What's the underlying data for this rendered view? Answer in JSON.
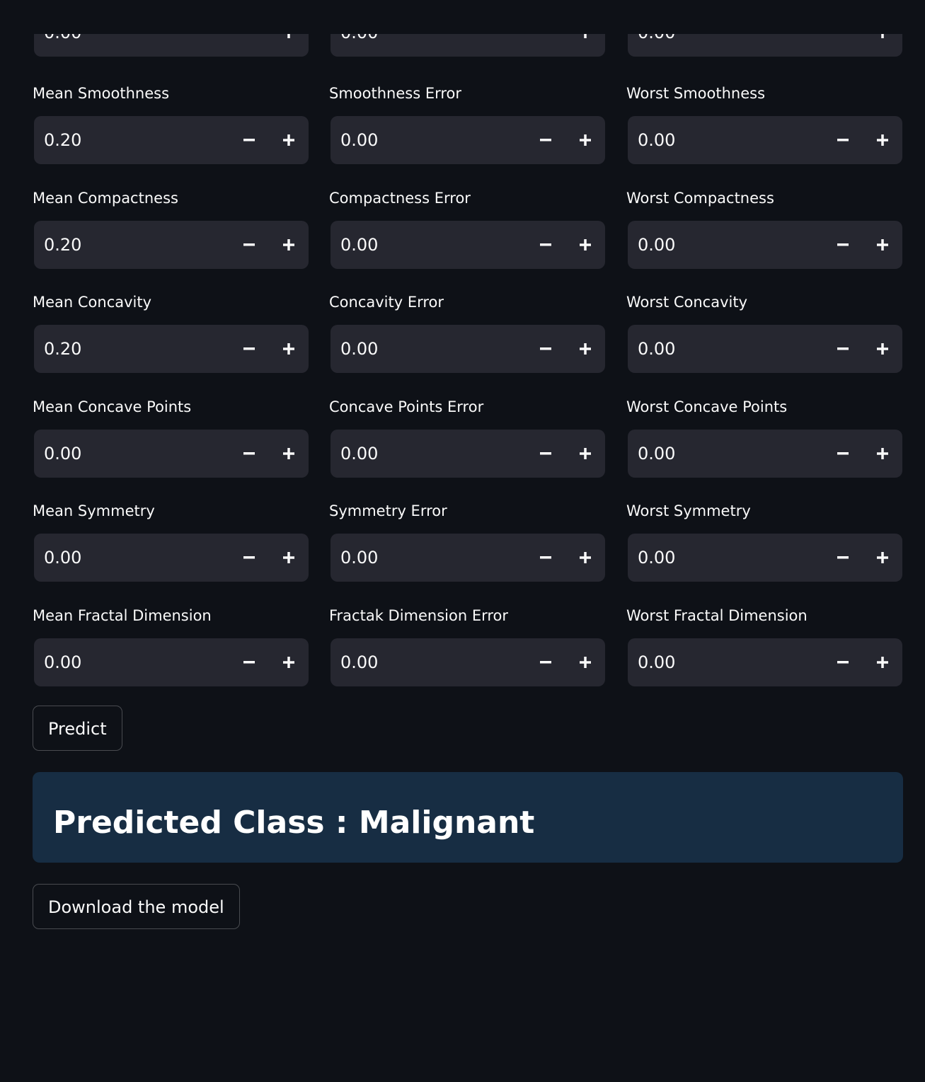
{
  "fields": {
    "top_partial": [
      {
        "value": "0.00"
      },
      {
        "value": "0.00"
      },
      {
        "value": "0.00"
      }
    ],
    "rows": [
      [
        {
          "label": "Mean Smoothness",
          "value": "0.20"
        },
        {
          "label": "Smoothness Error",
          "value": "0.00"
        },
        {
          "label": "Worst Smoothness",
          "value": "0.00"
        }
      ],
      [
        {
          "label": "Mean Compactness",
          "value": "0.20"
        },
        {
          "label": "Compactness Error",
          "value": "0.00"
        },
        {
          "label": "Worst Compactness",
          "value": "0.00"
        }
      ],
      [
        {
          "label": "Mean Concavity",
          "value": "0.20"
        },
        {
          "label": "Concavity Error",
          "value": "0.00"
        },
        {
          "label": "Worst Concavity",
          "value": "0.00"
        }
      ],
      [
        {
          "label": "Mean Concave Points",
          "value": "0.00"
        },
        {
          "label": "Concave Points Error",
          "value": "0.00"
        },
        {
          "label": "Worst Concave Points",
          "value": "0.00"
        }
      ],
      [
        {
          "label": "Mean Symmetry",
          "value": "0.00"
        },
        {
          "label": "Symmetry Error",
          "value": "0.00"
        },
        {
          "label": "Worst Symmetry",
          "value": "0.00"
        }
      ],
      [
        {
          "label": "Mean Fractal Dimension",
          "value": "0.00"
        },
        {
          "label": "Fractak Dimension Error",
          "value": "0.00"
        },
        {
          "label": "Worst Fractal Dimension",
          "value": "0.00"
        }
      ]
    ]
  },
  "actions": {
    "predict_label": "Predict",
    "download_label": "Download the model"
  },
  "result": {
    "text": "Predicted Class : Malignant"
  },
  "icons": {
    "decrement": "minus-icon",
    "increment": "plus-icon"
  },
  "colors": {
    "background": "#0e1117",
    "input_background": "#262730",
    "result_background": "#172d43",
    "text": "#fafafa"
  }
}
